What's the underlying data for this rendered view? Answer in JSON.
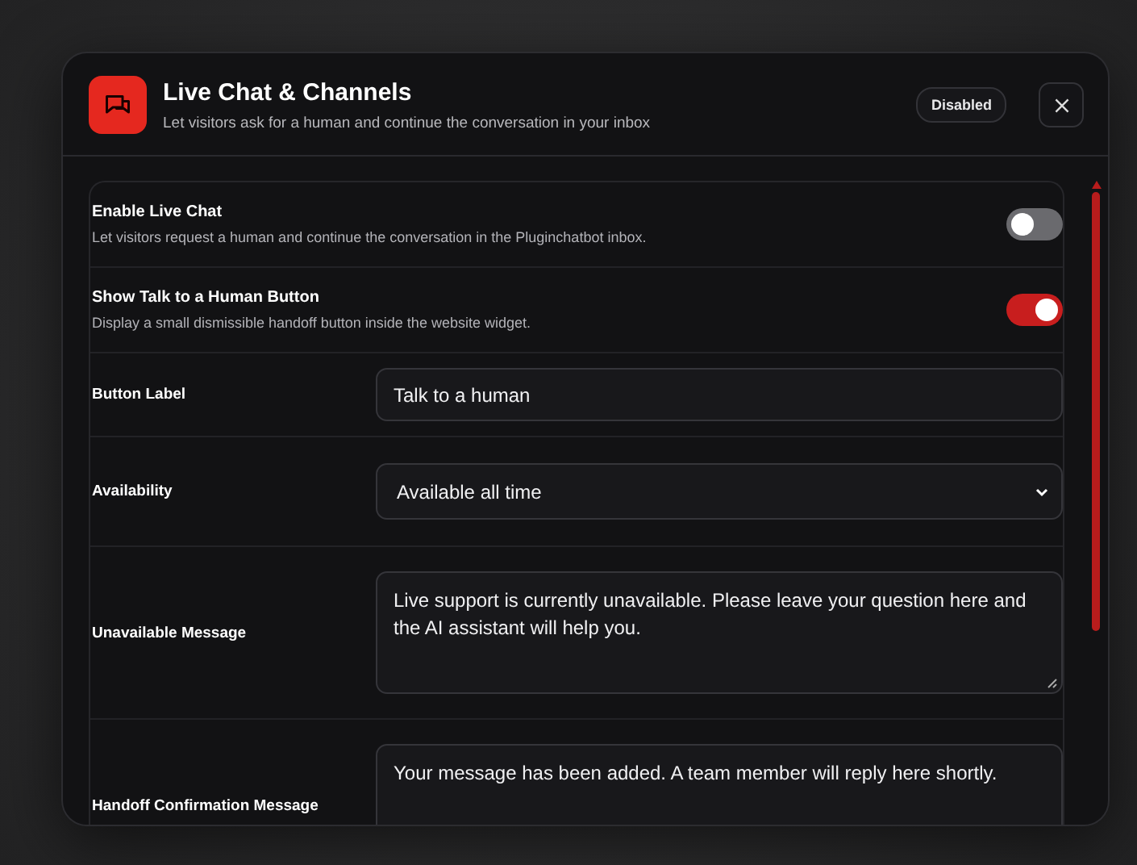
{
  "dialog": {
    "title": "Live Chat & Channels",
    "subtitle": "Let visitors ask for a human and continue the conversation in your inbox",
    "status_badge": "Disabled"
  },
  "settings": [
    {
      "kind": "toggle",
      "label": "Enable Live Chat",
      "description": "Let visitors request a human and continue the conversation in the Pluginchatbot inbox.",
      "on": false
    },
    {
      "kind": "toggle",
      "label": "Show Talk to a Human Button",
      "description": "Display a small dismissible handoff button inside the website widget.",
      "on": true
    },
    {
      "kind": "input",
      "label": "Button Label",
      "value": "Talk to a human"
    },
    {
      "kind": "select",
      "label": "Availability",
      "value": "Available all time"
    },
    {
      "kind": "textarea",
      "label": "Unavailable Message",
      "value": "Live support is currently unavailable. Please leave your question here and the AI assistant will help you."
    },
    {
      "kind": "textarea",
      "label": "Handoff Confirmation Message",
      "value": "Your message has been added. A team member will reply here shortly."
    }
  ]
}
